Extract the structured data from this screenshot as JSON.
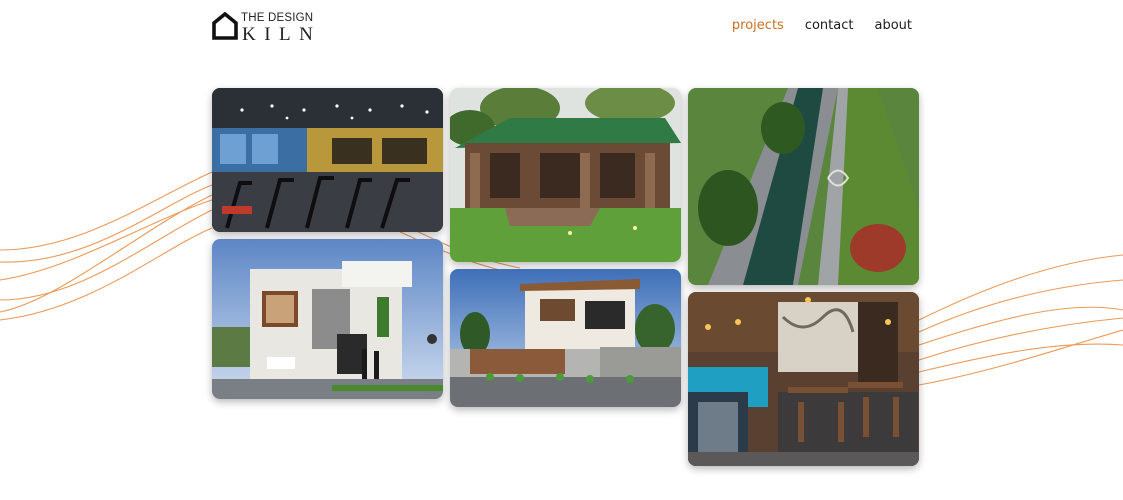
{
  "brand": {
    "line1": "THE DESIGN",
    "line2": "KILN",
    "logo_icon": "house-outline-icon"
  },
  "nav": {
    "items": [
      {
        "label": "projects",
        "active": true
      },
      {
        "label": "contact",
        "active": false
      },
      {
        "label": "about",
        "active": false
      }
    ]
  },
  "colors": {
    "accent": "#c9701f",
    "wave": "#e8893a",
    "text": "#1c1c1c"
  },
  "gallery": {
    "projects": [
      "gym-interior",
      "wooden-pavilion",
      "canal-landscape",
      "modern-villa-white",
      "modern-house-gate",
      "restaurant-interior"
    ]
  }
}
